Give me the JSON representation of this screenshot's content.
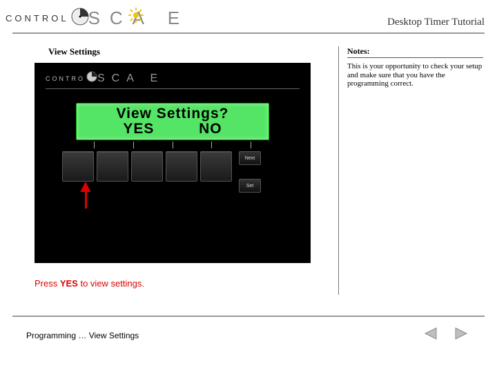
{
  "header": {
    "logo_part1": "CONTROL",
    "logo_part2": "SCA  E",
    "title": "Desktop Timer Tutorial"
  },
  "section": {
    "heading": "View Settings"
  },
  "device": {
    "logo_part1": "CONTRO",
    "logo_part2": "SCA  E",
    "lcd_line1": "View Settings?",
    "lcd_yes": "YES",
    "lcd_no": "NO",
    "side_next": "Next",
    "side_set": "Set"
  },
  "instruction": {
    "prefix": "Press ",
    "strong": "YES",
    "suffix": " to view settings."
  },
  "notes": {
    "heading": "Notes:",
    "body": "This is your opportunity to check your setup and make sure that you have the programming correct."
  },
  "footer": {
    "breadcrumb": "Programming … View Settings"
  }
}
